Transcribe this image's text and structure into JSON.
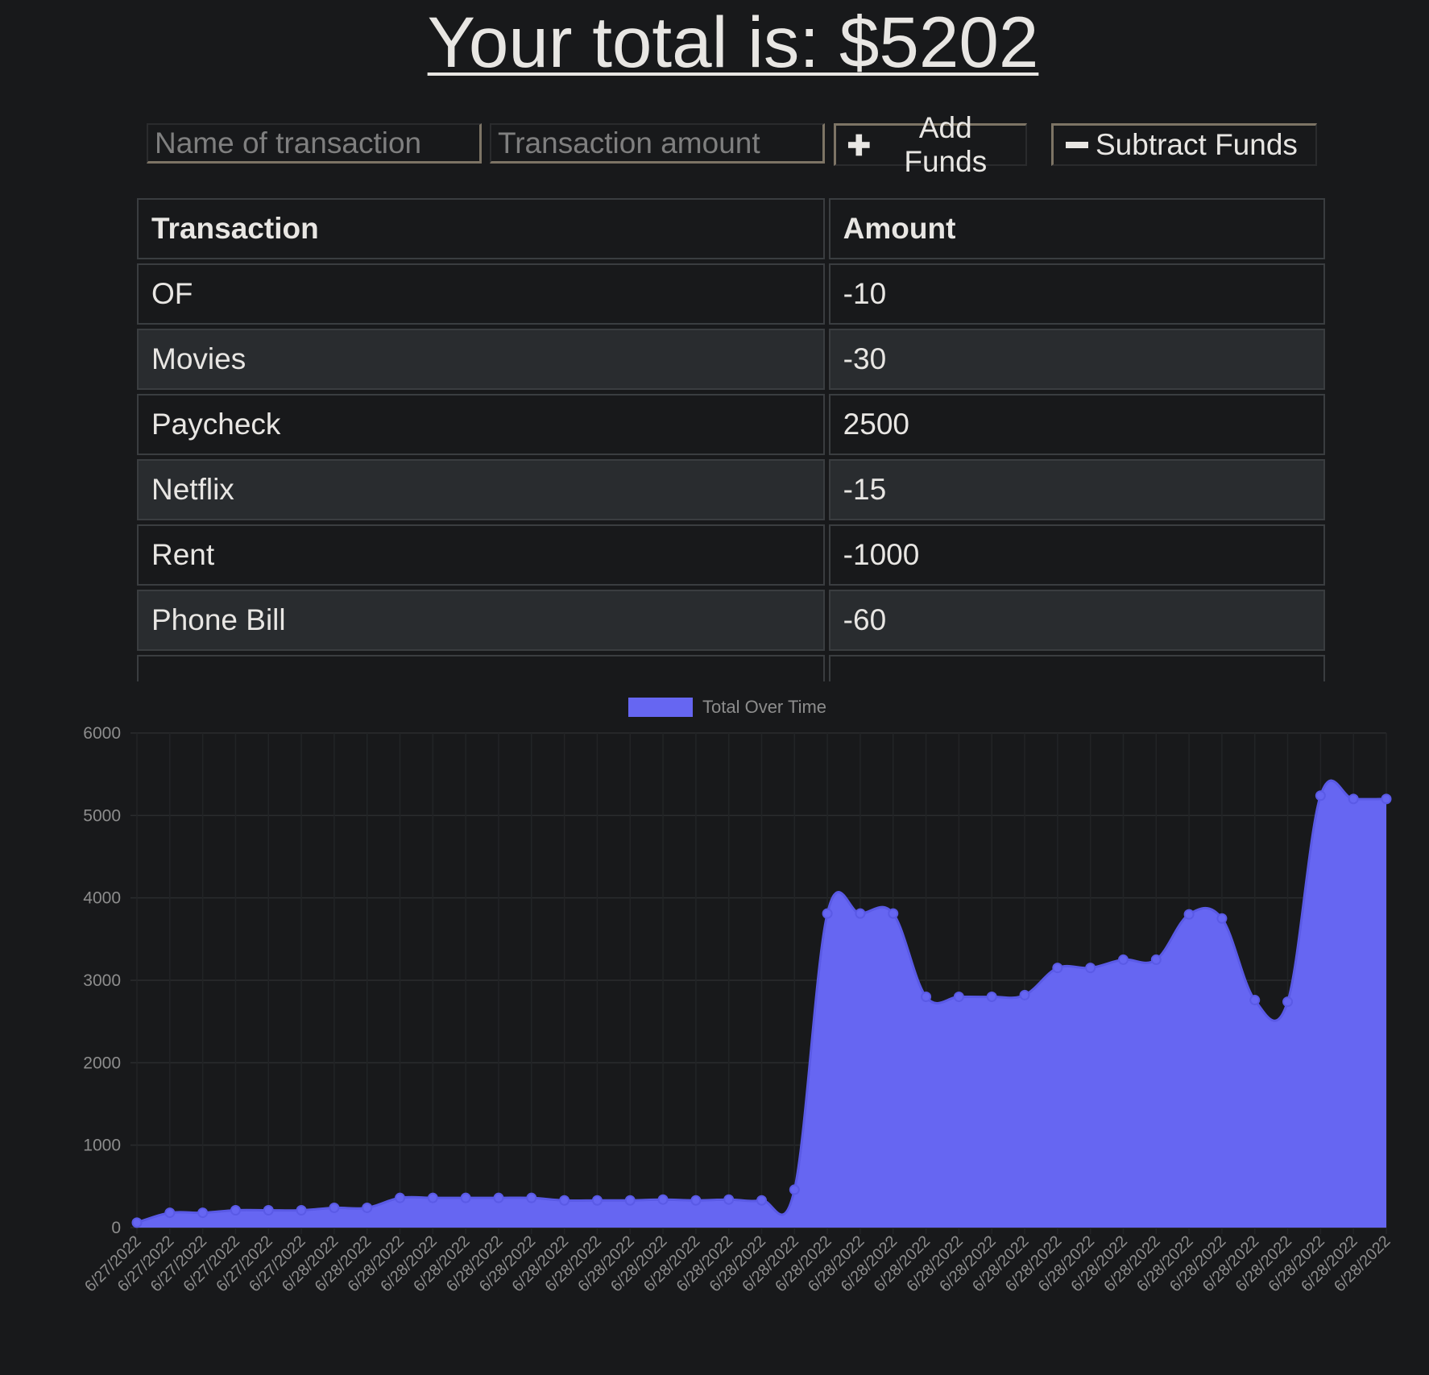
{
  "header": {
    "total_text": "Your total is: $5202"
  },
  "form": {
    "name_placeholder": "Name of transaction",
    "amount_placeholder": "Transaction amount",
    "add_label": "Add Funds",
    "subtract_label": "Subtract Funds",
    "add_icon": "plus-icon",
    "subtract_icon": "minus-icon"
  },
  "table": {
    "headers": [
      "Transaction",
      "Amount"
    ],
    "rows": [
      {
        "name": "OF",
        "amount": "-10"
      },
      {
        "name": "Movies",
        "amount": "-30"
      },
      {
        "name": "Paycheck",
        "amount": "2500"
      },
      {
        "name": "Netflix",
        "amount": "-15"
      },
      {
        "name": "Rent",
        "amount": "-1000"
      },
      {
        "name": "Phone Bill",
        "amount": "-60"
      }
    ]
  },
  "colors": {
    "background": "#18191b",
    "series": "#6666f2",
    "text": "#e8e6e3"
  },
  "chart_data": {
    "type": "area",
    "legend": "top",
    "grid": true,
    "ylim": [
      0,
      6000
    ],
    "yticks": [
      0,
      1000,
      2000,
      3000,
      4000,
      5000,
      6000
    ],
    "x": [
      "6/27/2022",
      "6/27/2022",
      "6/27/2022",
      "6/27/2022",
      "6/27/2022",
      "6/27/2022",
      "6/28/2022",
      "6/28/2022",
      "6/28/2022",
      "6/28/2022",
      "6/28/2022",
      "6/28/2022",
      "6/28/2022",
      "6/28/2022",
      "6/28/2022",
      "6/28/2022",
      "6/28/2022",
      "6/28/2022",
      "6/28/2022",
      "6/28/2022",
      "6/28/2022",
      "6/28/2022",
      "6/28/2022",
      "6/28/2022",
      "6/28/2022",
      "6/28/2022",
      "6/28/2022",
      "6/28/2022",
      "6/28/2022",
      "6/28/2022",
      "6/28/2022",
      "6/28/2022",
      "6/28/2022",
      "6/28/2022",
      "6/28/2022",
      "6/28/2022",
      "6/28/2022",
      "6/28/2022",
      "6/28/2022"
    ],
    "series": [
      {
        "name": "Total Over Time",
        "values": [
          60,
          180,
          180,
          210,
          210,
          210,
          240,
          240,
          360,
          360,
          360,
          360,
          360,
          330,
          330,
          330,
          340,
          330,
          340,
          330,
          460,
          3810,
          3810,
          3810,
          2800,
          2800,
          2800,
          2820,
          3150,
          3150,
          3250,
          3250,
          3800,
          3750,
          2760,
          2740,
          5240,
          5200,
          5200
        ]
      }
    ]
  }
}
